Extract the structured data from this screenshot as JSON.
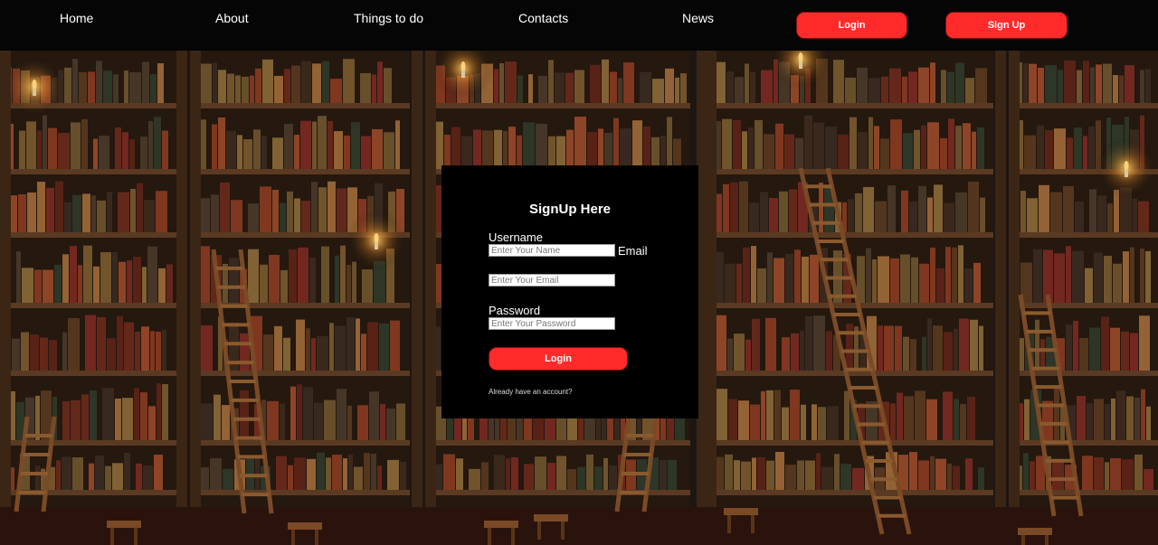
{
  "nav": {
    "items": [
      "Home",
      "About",
      "Things to do",
      "Contacts",
      "News"
    ],
    "login_label": "Login",
    "signup_label": "Sign Up"
  },
  "form": {
    "title": "SignUp Here",
    "username_label": "Username",
    "username_placeholder": "Enter Your Name",
    "email_label": "Email",
    "email_placeholder": "Enter Your Email",
    "password_label": "Password",
    "password_placeholder": "Enter Your Password",
    "submit_label": "Login",
    "account_link": "Already have an account?"
  },
  "colors": {
    "accent": "#ff2a2a",
    "nav_bg": "#050505",
    "panel_bg": "#000000"
  }
}
